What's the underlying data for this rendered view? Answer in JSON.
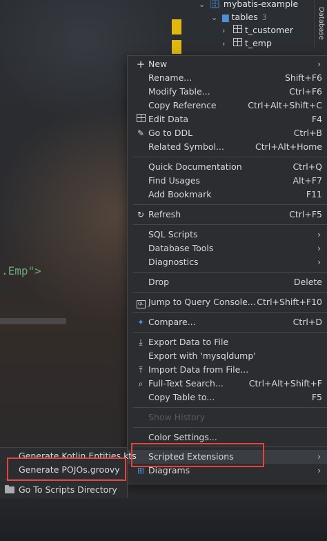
{
  "editor": {
    "code_fragment": ".Emp\">",
    "colors": {
      "string": "#6aab73",
      "marker": "#e2b710"
    }
  },
  "tree": {
    "project": "mybatis-example",
    "tables_label": "tables",
    "tables_count": "3",
    "items": [
      "t_customer",
      "t_emp"
    ],
    "side_tab": "Database"
  },
  "menu": {
    "items": [
      {
        "label": "New",
        "icon": "plus-icon",
        "submenu": true
      },
      {
        "label": "Rename...",
        "shortcut": "Shift+F6"
      },
      {
        "label": "Modify Table...",
        "shortcut": "Ctrl+F6"
      },
      {
        "label": "Copy Reference",
        "shortcut": "Ctrl+Alt+Shift+C"
      },
      {
        "label": "Edit Data",
        "icon": "table-icon",
        "shortcut": "F4"
      },
      {
        "label": "Go to DDL",
        "icon": "pencil-icon",
        "shortcut": "Ctrl+B"
      },
      {
        "label": "Related Symbol...",
        "shortcut": "Ctrl+Alt+Home"
      },
      {
        "label": "Quick Documentation",
        "shortcut": "Ctrl+Q"
      },
      {
        "label": "Find Usages",
        "shortcut": "Alt+F7"
      },
      {
        "label": "Add Bookmark",
        "shortcut": "F11"
      },
      {
        "label": "Refresh",
        "icon": "refresh-icon",
        "shortcut": "Ctrl+F5"
      },
      {
        "label": "SQL Scripts",
        "submenu": true
      },
      {
        "label": "Database Tools",
        "submenu": true
      },
      {
        "label": "Diagnostics",
        "submenu": true
      },
      {
        "label": "Drop",
        "shortcut": "Delete"
      },
      {
        "label": "Jump to Query Console...",
        "icon": "ql-icon",
        "shortcut": "Ctrl+Shift+F10"
      },
      {
        "label": "Compare...",
        "icon": "compare-icon",
        "shortcut": "Ctrl+D"
      },
      {
        "label": "Export Data to File",
        "icon": "download-icon"
      },
      {
        "label": "Export with 'mysqldump'"
      },
      {
        "label": "Import Data from File...",
        "icon": "import-icon"
      },
      {
        "label": "Full-Text Search...",
        "icon": "search-icon",
        "shortcut": "Ctrl+Alt+Shift+F"
      },
      {
        "label": "Copy Table to...",
        "shortcut": "F5"
      },
      {
        "label": "Show History",
        "disabled": true
      },
      {
        "label": "Color Settings..."
      },
      {
        "label": "Scripted Extensions",
        "submenu": true
      },
      {
        "label": "Diagrams",
        "icon": "diagram-icon",
        "submenu": true
      }
    ]
  },
  "submenu": {
    "items": [
      {
        "label": "Generate Kotlin Entities.kts"
      },
      {
        "label": "Generate POJOs.groovy"
      },
      {
        "label": "Go To Scripts Directory",
        "icon": "folder-icon"
      }
    ]
  },
  "highlight_color": "#e0463c"
}
